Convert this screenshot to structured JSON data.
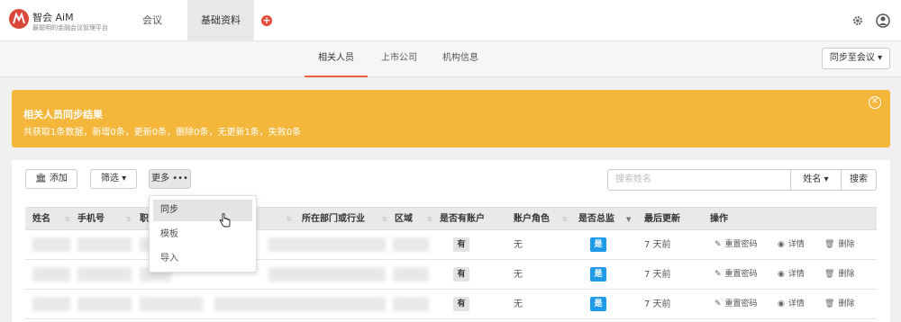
{
  "brand": {
    "title": "智会 AiM",
    "subtitle": "最聪明的金融会议管理平台"
  },
  "nav": {
    "items": [
      {
        "label": "会议"
      },
      {
        "label": "基础资料"
      }
    ],
    "add_icon": "plus-circle-icon",
    "settings_icon": "gear-icon",
    "user_icon": "user-circle-icon"
  },
  "subnav": {
    "tabs": [
      {
        "label": "相关人员",
        "active": true
      },
      {
        "label": "上市公司"
      },
      {
        "label": "机构信息"
      }
    ],
    "sync_button": "同步至会议 ▾"
  },
  "alert": {
    "title": "相关人员同步结果",
    "message": "共获取1条数据，新增0条，更新0条，删除0条，无更新1条，失败0条",
    "color": "#f5b73b"
  },
  "toolbar": {
    "add": "添加",
    "filter": "筛选 ▾",
    "more": "更多 •••",
    "search_placeholder": "搜索姓名",
    "search_field": "姓名 ▾",
    "search_button": "搜索"
  },
  "dropdown": {
    "items": [
      {
        "label": "同步"
      },
      {
        "label": "模板"
      },
      {
        "label": "导入"
      }
    ]
  },
  "table": {
    "columns": [
      "姓名",
      "手机号",
      "职",
      "所在部门或行业",
      "区域",
      "是否有账户",
      "账户角色",
      "是否总监",
      "最后更新",
      "操作"
    ],
    "rows": [
      {
        "has_account": "有",
        "role": "无",
        "is_director": "是",
        "updated": "7 天前",
        "reset": "重置密码",
        "detail": "详情",
        "delete": "删除"
      },
      {
        "has_account": "有",
        "role": "无",
        "is_director": "是",
        "updated": "7 天前",
        "reset": "重置密码",
        "detail": "详情",
        "delete": "删除"
      },
      {
        "has_account": "有",
        "role": "无",
        "is_director": "是",
        "updated": "7 天前",
        "reset": "重置密码",
        "detail": "详情",
        "delete": "删除"
      }
    ]
  }
}
